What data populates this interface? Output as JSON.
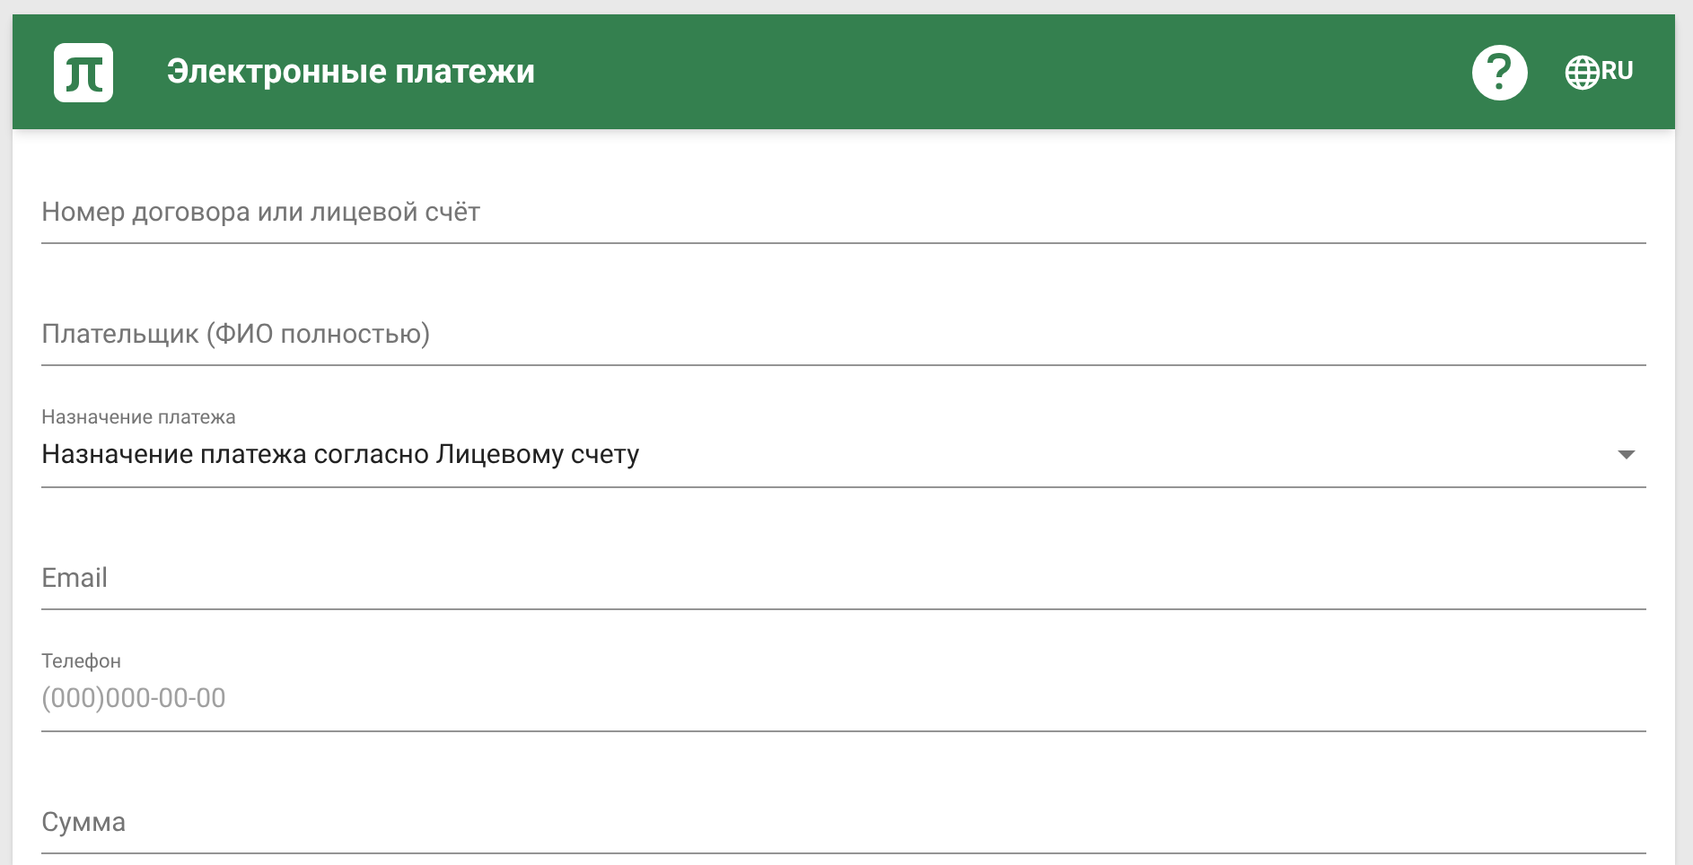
{
  "header": {
    "title": "Электронные платежи",
    "language": "RU"
  },
  "fields": [
    {
      "kind": "input",
      "placeholder": "Номер договора или лицевой счёт"
    },
    {
      "kind": "input",
      "placeholder": "Плательщик (ФИО полностью)"
    },
    {
      "kind": "select",
      "label": "Назначение платежа",
      "value": "Назначение платежа согласно Лицевому счету"
    },
    {
      "kind": "input",
      "placeholder": "Email"
    },
    {
      "kind": "labeled",
      "label": "Телефон",
      "placeholder": "(000)000-00-00"
    },
    {
      "kind": "input",
      "placeholder": "Сумма"
    }
  ]
}
